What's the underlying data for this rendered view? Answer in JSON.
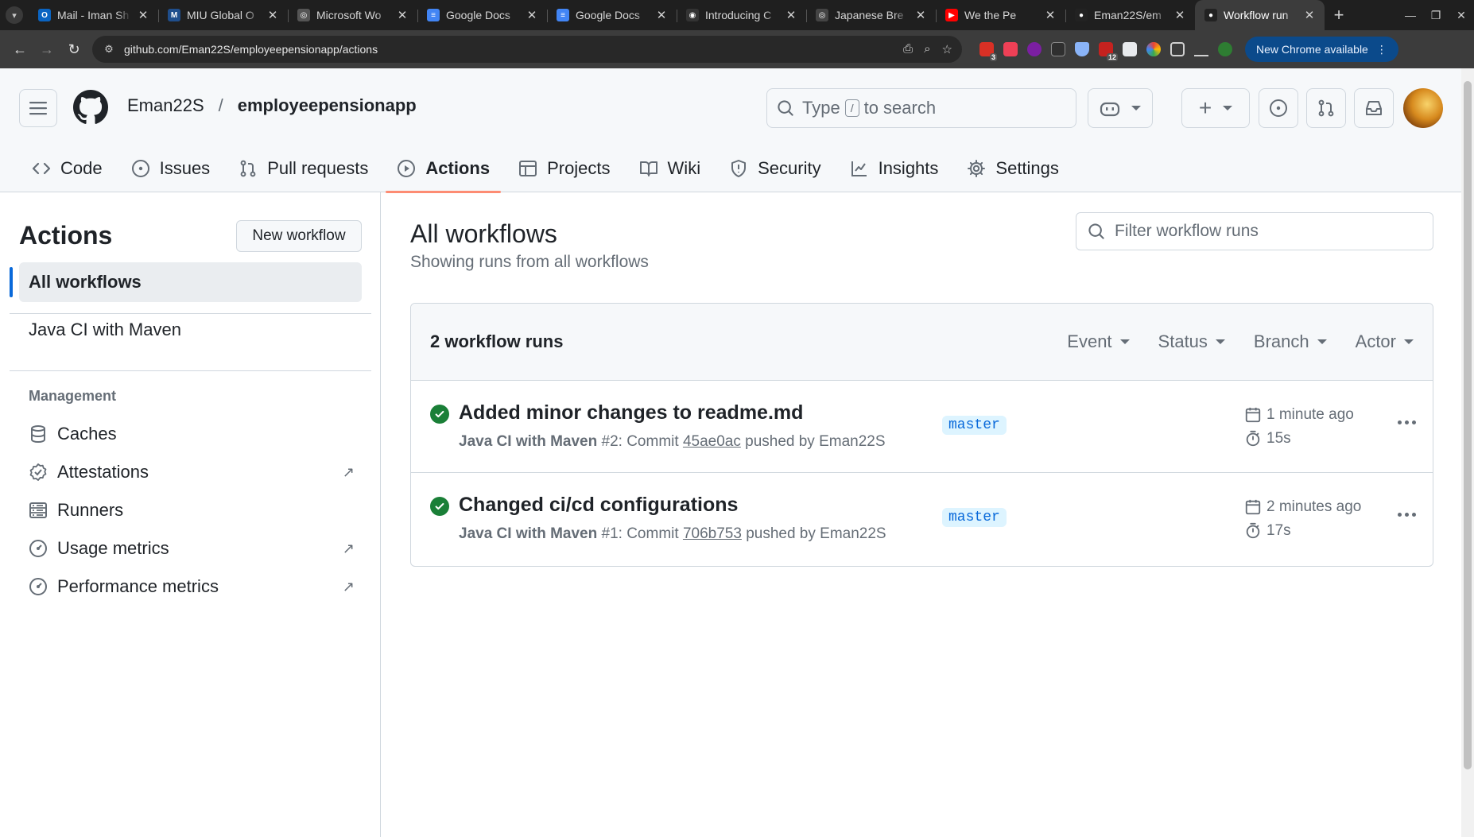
{
  "browser": {
    "tabs": [
      {
        "title": "Mail - Iman Sh",
        "fav_color": "#0a64c2",
        "fav_text": "O"
      },
      {
        "title": "MIU Global O",
        "fav_color": "#1f4e8c",
        "fav_text": "M"
      },
      {
        "title": "Microsoft Wo",
        "fav_color": "#555555",
        "fav_text": "◎"
      },
      {
        "title": "Google Docs",
        "fav_color": "#4285f4",
        "fav_text": "≡"
      },
      {
        "title": "Google Docs",
        "fav_color": "#4285f4",
        "fav_text": "≡"
      },
      {
        "title": "Introducing C",
        "fav_color": "#333333",
        "fav_text": "◉"
      },
      {
        "title": "Japanese Bre",
        "fav_color": "#444444",
        "fav_text": "◎"
      },
      {
        "title": "We the Pe",
        "fav_color": "#ff0000",
        "fav_text": "▶"
      },
      {
        "title": "Eman22S/em",
        "fav_color": "#222222",
        "fav_text": "●"
      },
      {
        "title": "Workflow run",
        "fav_color": "#222222",
        "fav_text": "●"
      }
    ],
    "url": "github.com/Eman22S/employeepensionapp/actions",
    "chrome_update": "New Chrome available",
    "ext_badges": [
      "3",
      "12"
    ]
  },
  "header": {
    "owner": "Eman22S",
    "separator": "/",
    "repo": "employeepensionapp",
    "search_prefix": "Type",
    "search_key": "/",
    "search_suffix": "to search"
  },
  "repo_nav": [
    {
      "label": "Code",
      "icon": "code-icon"
    },
    {
      "label": "Issues",
      "icon": "issue-icon"
    },
    {
      "label": "Pull requests",
      "icon": "pull-request-icon"
    },
    {
      "label": "Actions",
      "icon": "play-icon",
      "active": true
    },
    {
      "label": "Projects",
      "icon": "table-icon"
    },
    {
      "label": "Wiki",
      "icon": "book-icon"
    },
    {
      "label": "Security",
      "icon": "shield-icon"
    },
    {
      "label": "Insights",
      "icon": "graph-icon"
    },
    {
      "label": "Settings",
      "icon": "gear-icon"
    }
  ],
  "sidebar": {
    "title": "Actions",
    "new_workflow": "New workflow",
    "all_workflows": "All workflows",
    "workflows": [
      "Java CI with Maven"
    ],
    "management_heading": "Management",
    "management": [
      {
        "label": "Caches",
        "icon": "database-icon",
        "external": false
      },
      {
        "label": "Attestations",
        "icon": "verified-icon",
        "external": true
      },
      {
        "label": "Runners",
        "icon": "server-icon",
        "external": false
      },
      {
        "label": "Usage metrics",
        "icon": "meter-icon",
        "external": true
      },
      {
        "label": "Performance metrics",
        "icon": "meter-icon",
        "external": true
      }
    ]
  },
  "main": {
    "title": "All workflows",
    "subtitle": "Showing runs from all workflows",
    "filter_placeholder": "Filter workflow runs",
    "runs_count": "2 workflow runs",
    "filters": [
      "Event",
      "Status",
      "Branch",
      "Actor"
    ],
    "runs": [
      {
        "title": "Added minor changes to readme.md",
        "workflow": "Java CI with Maven",
        "number": "#2",
        "commit_label": ": Commit",
        "commit": "45ae0ac",
        "pushed_by": "pushed by Eman22S",
        "branch": "master",
        "when": "1 minute ago",
        "duration": "15s",
        "status": "success"
      },
      {
        "title": "Changed ci/cd configurations",
        "workflow": "Java CI with Maven",
        "number": "#1",
        "commit_label": ": Commit",
        "commit": "706b753",
        "pushed_by": "pushed by Eman22S",
        "branch": "master",
        "when": "2 minutes ago",
        "duration": "17s",
        "status": "success"
      }
    ]
  },
  "colors": {
    "accent_underline": "#fd8c73",
    "success": "#1a7f37",
    "link": "#0969da"
  }
}
